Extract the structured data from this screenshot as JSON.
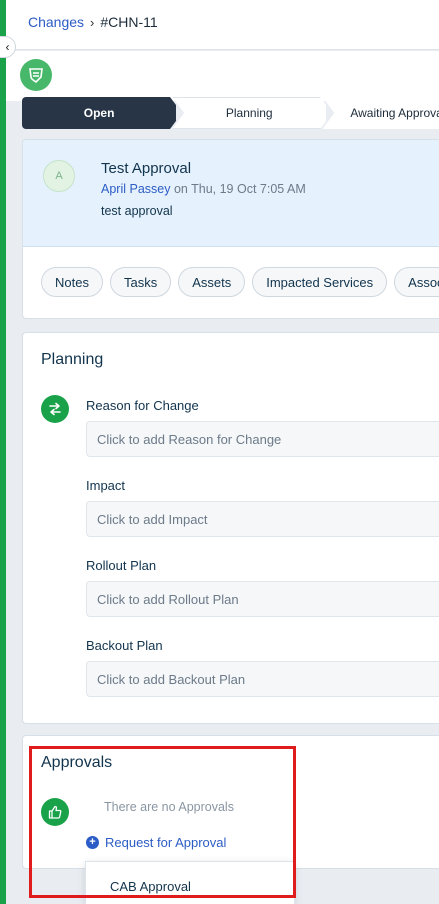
{
  "breadcrumb": {
    "parent": "Changes",
    "separator": "›",
    "current": "#CHN-11"
  },
  "colors": {
    "accent_green": "#1aa24a",
    "link_blue": "#2c5cc5",
    "highlight_red": "#e01b1b",
    "stepper_active": "#283547"
  },
  "stepper": {
    "steps": [
      "Open",
      "Planning",
      "Awaiting Approval"
    ],
    "active": "Open"
  },
  "ticket": {
    "avatar_initial": "A",
    "title": "Test Approval",
    "author": "April Passey",
    "meta_rest": " on Thu, 19 Oct 7:05 AM",
    "description": "test approval"
  },
  "tabs": [
    "Notes",
    "Tasks",
    "Assets",
    "Impacted Services",
    "Associations"
  ],
  "planning": {
    "title": "Planning",
    "icon": "swap-arrows-icon",
    "fields": [
      {
        "label": "Reason for Change",
        "placeholder": "Click to add Reason for Change"
      },
      {
        "label": "Impact",
        "placeholder": "Click to add Impact"
      },
      {
        "label": "Rollout Plan",
        "placeholder": "Click to add Rollout Plan"
      },
      {
        "label": "Backout Plan",
        "placeholder": "Click to add Backout Plan"
      }
    ]
  },
  "approvals": {
    "title": "Approvals",
    "icon": "thumbs-up-icon",
    "empty_text": "There are no Approvals",
    "request_label": "Request for Approval",
    "dropdown_items": [
      "CAB Approval"
    ]
  }
}
